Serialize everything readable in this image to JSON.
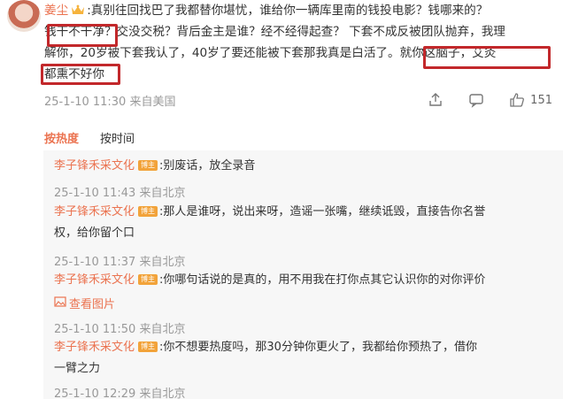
{
  "main_comment": {
    "username": "姜尘",
    "separator": ":",
    "text_line1": "真别往回找巴了我都替你堪忧，谁给你一辆库里南的钱投电影？钱哪来的？",
    "text_line2": "钱干不干净？交没交税？背后金主是谁？经不经得起查？ 下套不成反被团队抛弃，我理",
    "text_line3": "解你，20岁被下套我认了，40岁了要还能被下套那我真是白活了。就你这脑子，艾灸",
    "text_line4": "都熏不好你",
    "timestamp": "25-1-10 11:30 来自美国",
    "like_count": "151"
  },
  "sort_tabs": {
    "hot": "按热度",
    "time": "按时间"
  },
  "replies": [
    {
      "username": "李子锋禾采文化",
      "badge": "博主",
      "text": ":别废话，放全录音",
      "timestamp": "25-1-10 11:43 来自北京"
    },
    {
      "username": "李子锋禾采文化",
      "badge": "博主",
      "text": ":那人是谁呀，说出来呀，造谣一张嘴，继续诋毁，直接告你名誉",
      "text_line2": "权，给你留个口",
      "timestamp": "25-1-10 11:37 来自北京"
    },
    {
      "username": "李子锋禾采文化",
      "badge": "博主",
      "text": ":你哪句话说的是真的，用不用我在打你点其它认识你的对你评价",
      "view_image": "查看图片",
      "timestamp": "25-1-10 11:50 来自北京"
    },
    {
      "username": "李子锋禾采文化",
      "badge": "博主",
      "text": ":你不想要热度吗，那30分钟你更火了，我都给你预热了，借你",
      "text_line2": "一臂之力",
      "timestamp": "25-1-10 12:29 来自北京"
    }
  ],
  "colors": {
    "accent": "#eb7350",
    "highlight_box": "#c2282b",
    "meta": "#999999",
    "reply_bg": "#f7f7f7"
  }
}
